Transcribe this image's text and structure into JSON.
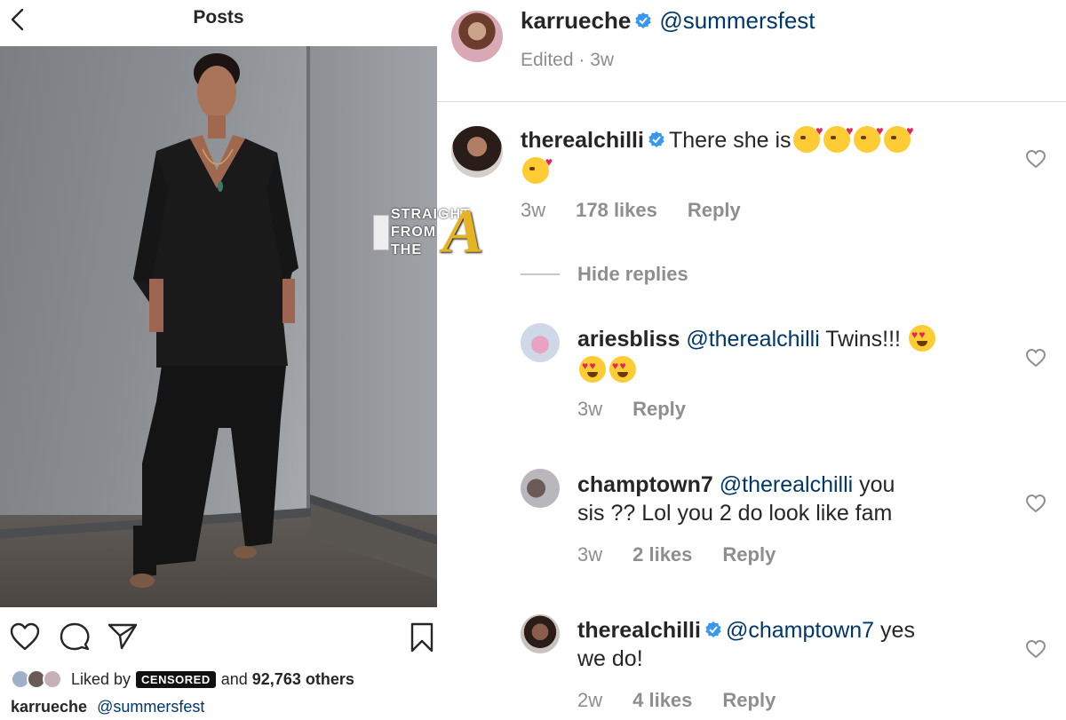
{
  "left": {
    "topbar": {
      "title": "Posts",
      "back_icon": "chevron-left-icon"
    },
    "actions": {
      "like_icon": "heart-icon",
      "comment_icon": "comment-bubble-icon",
      "share_icon": "paper-plane-icon",
      "save_icon": "bookmark-icon"
    },
    "liked": {
      "prefix": "Liked by",
      "censored_label": "CENSORED",
      "and": "and",
      "count": "92,763 others"
    },
    "caption": {
      "user": "karrueche",
      "mention": "@summersfest"
    }
  },
  "right": {
    "header": {
      "user": "karrueche",
      "mention": "@summersfest",
      "meta": "Edited · 3w"
    },
    "comments": [
      {
        "user": "therealchilli",
        "verified": true,
        "text": "There she is",
        "time": "3w",
        "likes": "178 likes",
        "reply": "Reply"
      },
      {
        "user": "ariesbliss",
        "verified": false,
        "mention": "@therealchilli",
        "text": "Twins!!!",
        "time": "3w",
        "reply": "Reply"
      },
      {
        "user": "champtown7",
        "verified": false,
        "mention": "@therealchilli",
        "text_line1": "you",
        "text_line2": "sis ?? Lol you 2 do look like fam",
        "time": "3w",
        "likes": "2 likes",
        "reply": "Reply"
      },
      {
        "user": "therealchilli",
        "verified": true,
        "mention": "@champtown7",
        "text_line1": "yes",
        "text_line2": "we do!",
        "time": "2w",
        "likes": "4 likes",
        "reply": "Reply"
      }
    ],
    "hide_replies": "Hide replies"
  },
  "watermark": {
    "line1": "STRAIGHT",
    "line2": "FROM",
    "line3": "THE",
    "letter": "A"
  },
  "colors": {
    "link": "#00376b",
    "muted": "#8e8e8e",
    "verified": "#3897f0",
    "text": "#262626"
  }
}
